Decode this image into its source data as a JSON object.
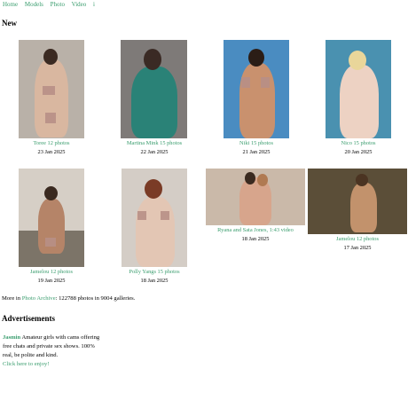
{
  "nav": {
    "items": [
      "Home",
      "Models",
      "Photo",
      "Video",
      "i"
    ]
  },
  "sections": {
    "new_title": "New",
    "ads_title": "Advertisements"
  },
  "galleries": [
    {
      "caption": "Toree 12 photos",
      "date": "23 Jan 2025",
      "bg": "#b9b1a8",
      "fig": "#d9b7a0"
    },
    {
      "caption": "Martina Mink 15 photos",
      "date": "22 Jan 2025",
      "bg": "#7e7a78",
      "fig": "#2a8277"
    },
    {
      "caption": "Niki 15 photos",
      "date": "21 Jan 2025",
      "bg": "#4a8cc1",
      "fig": "#c9916e"
    },
    {
      "caption": "Nico 15 photos",
      "date": "20 Jan 2025",
      "bg": "#4a91b0",
      "fig": "#edd2c3"
    },
    {
      "caption": "Jamelou 12 photos",
      "date": "19 Jan 2025",
      "bg": "#d6cfc6",
      "fig": "#b58468"
    },
    {
      "caption": "Polly Yangs 15 photos",
      "date": "18 Jan 2025",
      "bg": "#d4cdc6",
      "fig": "#e3c6b4"
    },
    {
      "caption": "Ryana and Sata Jones, 1:43 video",
      "date": "18 Jan 2025",
      "bg": "#cab9a9",
      "fig": "#d7a58c"
    },
    {
      "caption": "Jamelou 12 photos",
      "date": "17 Jan 2025",
      "bg": "#5b4e38",
      "fig": "#c2926c"
    }
  ],
  "more": {
    "prefix": "More in ",
    "link": "Photo Archive",
    "suffix": ": 122788 photos in 9004 galleries."
  },
  "ad": {
    "name": "Jasmin",
    "text": " Amateur girls with cams offering free chats and private sex shows. 100% real, be polite and kind.",
    "link": "Click here to enjoy!"
  }
}
